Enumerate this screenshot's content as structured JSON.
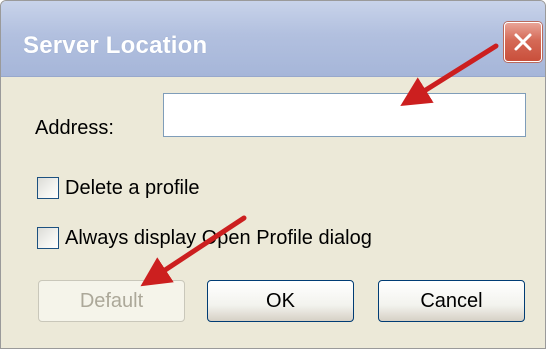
{
  "window": {
    "title": "Server Location"
  },
  "address": {
    "label": "Address:",
    "value": "",
    "placeholder": ""
  },
  "checkboxes": [
    {
      "label": "Delete a profile",
      "checked": false
    },
    {
      "label": "Always display Open Profile dialog",
      "checked": false
    }
  ],
  "buttons": {
    "default_label": "Default",
    "ok_label": "OK",
    "cancel_label": "Cancel"
  },
  "colors": {
    "titlebar": "#b2c0df",
    "close_button": "#d56a57",
    "dialog_background": "#ece9d8",
    "annotation_arrow": "#cc1f1f"
  },
  "icons": {
    "close": "close-icon"
  }
}
